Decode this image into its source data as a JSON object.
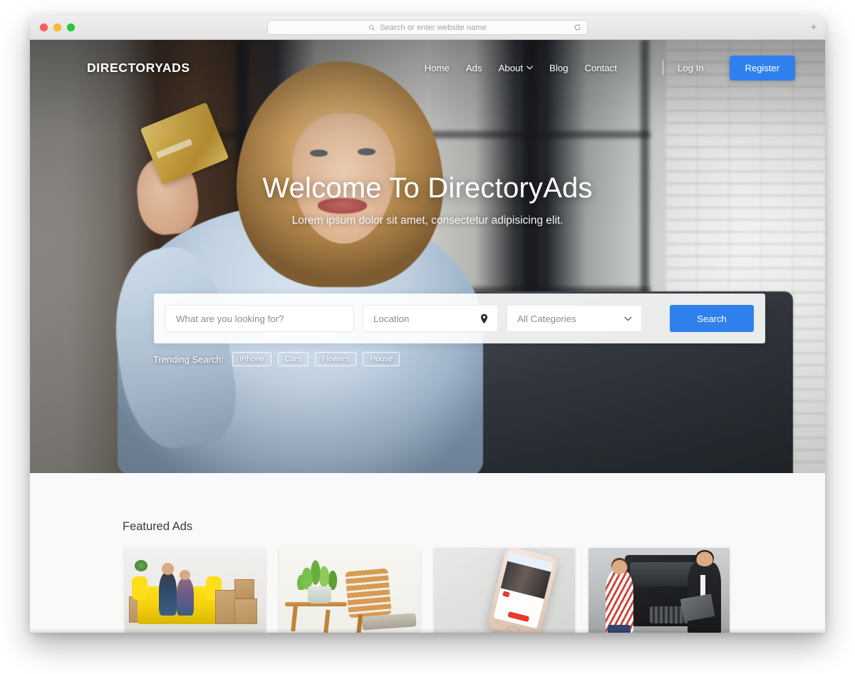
{
  "browser": {
    "address_placeholder": "Search or enter website name",
    "search_icon": "search-icon",
    "reload_icon": "reload-icon",
    "new_tab_label": "+",
    "traffic_lights": [
      "close",
      "minimize",
      "zoom"
    ]
  },
  "site": {
    "logo": "DIRECTORYADS",
    "nav": [
      {
        "label": "Home",
        "has_caret": false
      },
      {
        "label": "Ads",
        "has_caret": false
      },
      {
        "label": "About",
        "has_caret": true
      },
      {
        "label": "Blog",
        "has_caret": false
      },
      {
        "label": "Contact",
        "has_caret": false
      }
    ],
    "login_label": "Log In",
    "register_label": "Register"
  },
  "hero": {
    "title": "Welcome To DirectoryAds",
    "subtitle": "Lorem ipsum dolor sit amet, consectetur adipisicing elit.",
    "search": {
      "keyword_placeholder": "What are you looking for?",
      "location_placeholder": "Location",
      "category_selected": "All Categories",
      "category_options": [
        "All Categories"
      ],
      "button_label": "Search",
      "location_icon": "map-pin-icon",
      "category_icon": "chevron-down-icon"
    },
    "trending": {
      "label": "Trending Search:",
      "tags": [
        "iPhone",
        "Cars",
        "Flowers",
        "House"
      ]
    }
  },
  "featured": {
    "title": "Featured Ads",
    "cards": [
      {
        "image_alt": "couple-sitting-on-yellow-sofa-with-moving-boxes"
      },
      {
        "image_alt": "potted-plant-on-wooden-table-beside-wooden-chair"
      },
      {
        "image_alt": "rose-gold-smartphone-on-grey-surface"
      },
      {
        "image_alt": "two-men-shaking-hands-in-front-of-black-pickup-truck"
      }
    ]
  },
  "colors": {
    "accent_blue": "#2f80ed",
    "featured_bg": "#f9f9f9",
    "heading_text": "#3b3b3b",
    "placeholder_text": "#8c8c8c"
  }
}
